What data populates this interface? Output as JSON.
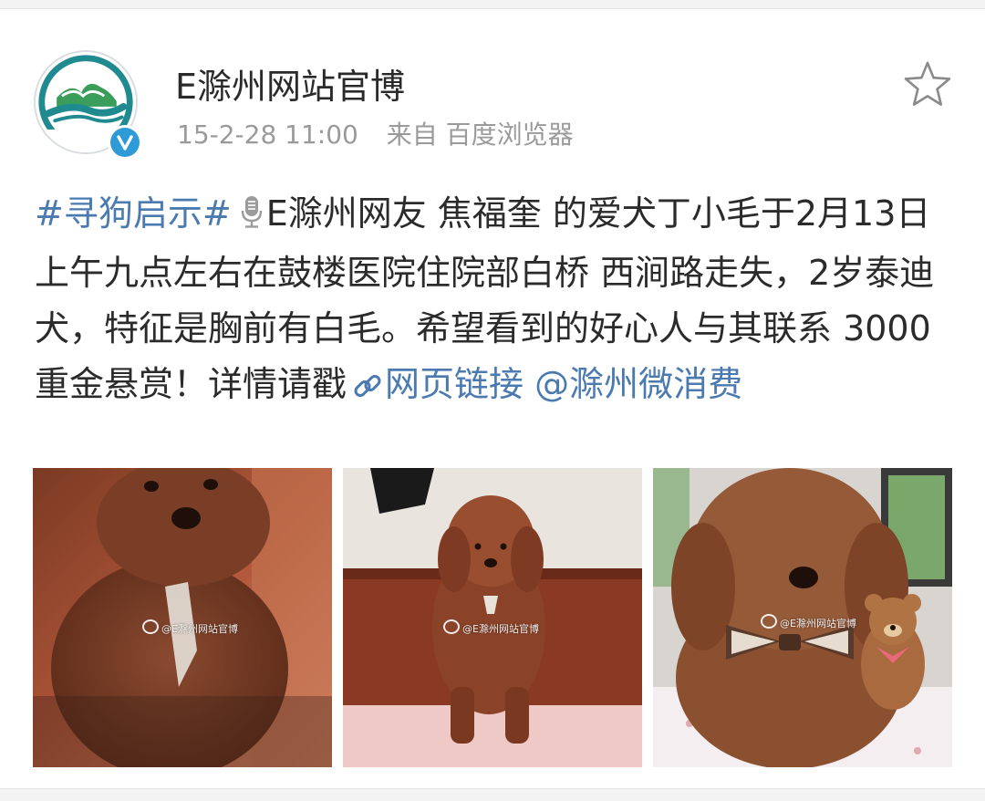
{
  "post": {
    "author": "E滁州网站官博",
    "timestamp": "15-2-28 11:00",
    "source": "来自 百度浏览器",
    "favorite_icon": "star-outline-icon",
    "verified_icon": "verified-badge-icon"
  },
  "content": {
    "hashtag": "#寻狗启示#",
    "voice_icon": "microphone-icon",
    "text_main": "E滁州网友 焦福奎 的爱犬丁小毛于2月13日上午九点左右在鼓楼医院住院部白桥 西涧路走失，2岁泰迪犬，特征是胸前有白毛。希望看到的好心人与其联系 3000重金悬赏！详情请戳",
    "link_icon": "link-icon",
    "link_text": "网页链接",
    "mention": "@滁州微消费"
  },
  "photos": [
    {
      "watermark": "@E滁州网站官博",
      "subject": "red poodle close-up"
    },
    {
      "watermark": "@E滁州网站官博",
      "subject": "red poodle sitting"
    },
    {
      "watermark": "@E滁州网站官博",
      "subject": "red poodle with bow tie and teddy bear"
    }
  ],
  "colors": {
    "link_blue": "#4a7ab0",
    "verified_blue": "#2f9bd6",
    "meta_gray": "#9a9a9a",
    "logo_teal": "#1f8a8f",
    "logo_green": "#3a9e5a"
  }
}
